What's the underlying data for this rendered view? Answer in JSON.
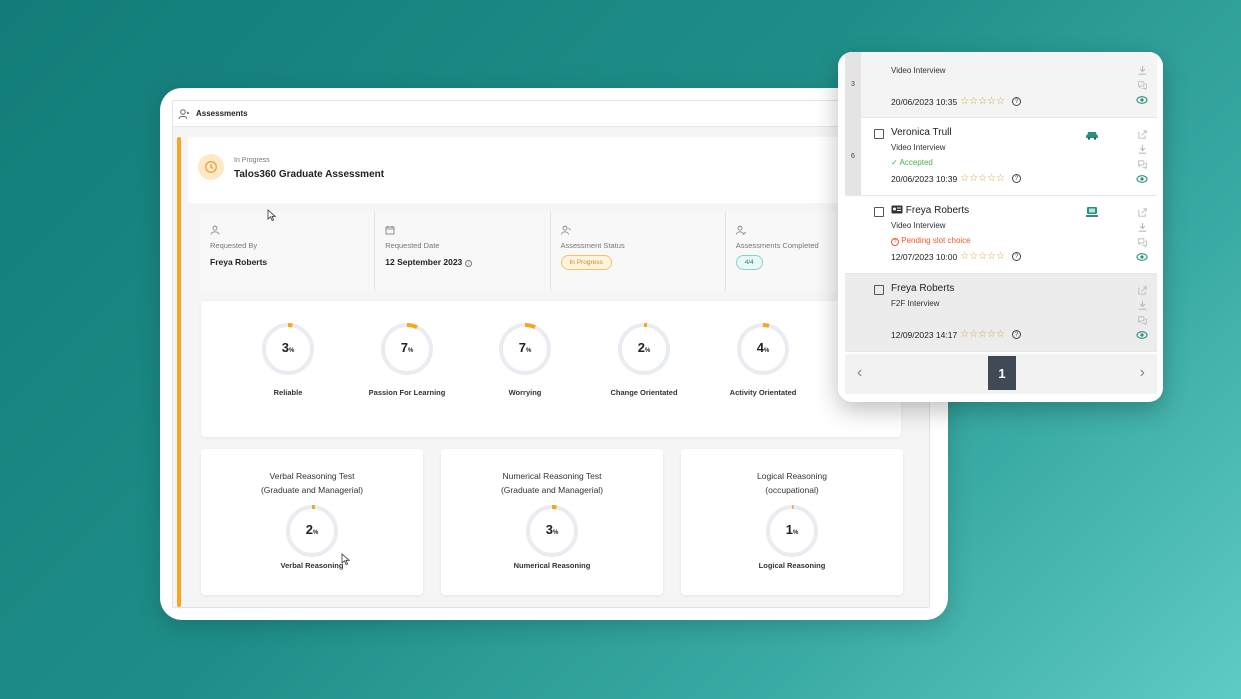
{
  "assessments_panel": {
    "title": "Assessments",
    "header": {
      "status": "In Progress",
      "title": "Talos360 Graduate Assessment"
    },
    "info": [
      {
        "label": "Requested By",
        "value": "Freya Roberts",
        "icon": "user-icon"
      },
      {
        "label": "Requested Date",
        "value": "12 September 2023",
        "icon": "calendar-icon"
      },
      {
        "label": "Assessment Status",
        "value": "In Progress",
        "icon": "user-status-icon"
      },
      {
        "label": "Assessments Completed",
        "value": "4/4",
        "icon": "user-check-icon"
      }
    ],
    "traits": [
      {
        "value": "3",
        "unit": "%",
        "label": "Reliable"
      },
      {
        "value": "7",
        "unit": "%",
        "label": "Passion For Learning"
      },
      {
        "value": "7",
        "unit": "%",
        "label": "Worrying"
      },
      {
        "value": "2",
        "unit": "%",
        "label": "Change Orientated"
      },
      {
        "value": "4",
        "unit": "%",
        "label": "Activity Orientated"
      }
    ],
    "tests": [
      {
        "title_line1": "Verbal Reasoning Test",
        "title_line2": "(Graduate and Managerial)",
        "value": "2",
        "unit": "%",
        "label": "Verbal Reasoning"
      },
      {
        "title_line1": "Numerical Reasoning Test",
        "title_line2": "(Graduate and Managerial)",
        "value": "3",
        "unit": "%",
        "label": "Numerical Reasoning"
      },
      {
        "title_line1": "Logical Reasoning",
        "title_line2": "(occupational)",
        "value": "1",
        "unit": "%",
        "label": "Logical Reasoning"
      }
    ]
  },
  "candidate_list": {
    "rows": [
      {
        "index": "3",
        "name": "",
        "type": "Video Interview",
        "status": "",
        "date": "20/06/2023 10:35"
      },
      {
        "index": "6",
        "name": "Veronica Trull",
        "type": "Video Interview",
        "status": "✓ Accepted",
        "date": "20/06/2023 10:39"
      },
      {
        "index": "",
        "name": "Freya Roberts",
        "type": "Video Interview",
        "status": "Pending slot choice",
        "date": "12/07/2023 10:00"
      },
      {
        "index": "",
        "name": "Freya Roberts",
        "type": "F2F Interview",
        "status": "",
        "date": "12/09/2023 14:17"
      }
    ],
    "stars": "☆☆☆☆☆",
    "help_glyph": "?",
    "pager": {
      "prev": "‹",
      "page": "1",
      "next": "›"
    }
  },
  "colors": {
    "accent": "#f5a623",
    "teal": "#2a8f86",
    "accepted": "#4caf50",
    "pending": "#f0592a",
    "background_gradient": [
      "#137c78",
      "#5fcbc4"
    ]
  }
}
